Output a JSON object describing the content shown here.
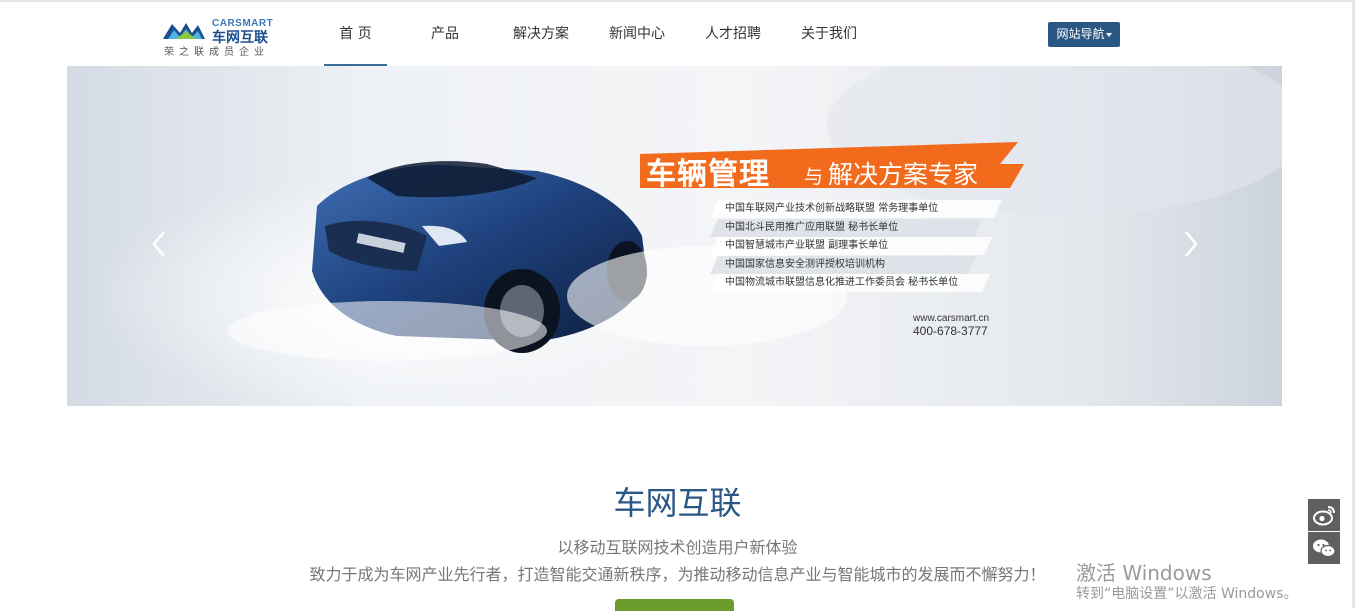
{
  "logo": {
    "brand_en": "CARSMART",
    "brand_cn": "车网互联",
    "tagline": "荣之联成员企业"
  },
  "nav": {
    "items": [
      {
        "label": "首 页",
        "active": true
      },
      {
        "label": "产品"
      },
      {
        "label": "解决方案"
      },
      {
        "label": "新闻中心"
      },
      {
        "label": "人才招聘"
      },
      {
        "label": "关于我们"
      }
    ],
    "site_nav_label": "网站导航"
  },
  "banner": {
    "headline": "车辆管理",
    "headline_yu": "与",
    "headline_rest": "解决方案专家",
    "memberships": [
      "中国车联网产业技术创新战略联盟 常务理事单位",
      "中国北斗民用推广应用联盟 秘书长单位",
      "中国智慧城市产业联盟 副理事长单位",
      "中国国家信息安全测评授权培训机构",
      "中国物流城市联盟信息化推进工作委员会 秘书长单位"
    ],
    "website": "www.carsmart.cn",
    "phone": "400-678-3777",
    "accent_color": "#f26b1d"
  },
  "intro": {
    "title": "车网互联",
    "subtitle": "以移动互联网技术创造用户新体验",
    "description": "致力于成为车网产业先行者，打造智能交通新秩序，为推动移动信息产业与智能城市的发展而不懈努力！"
  },
  "social": {
    "weibo_icon": "weibo-icon",
    "wechat_icon": "wechat-icon"
  },
  "watermark": {
    "line1": "激活 Windows",
    "line2": "转到“电脑设置”以激活 Windows。"
  },
  "colors": {
    "brand_blue": "#2b5784",
    "nav_underline": "#3a6c94",
    "green_button": "#6a9b2b"
  }
}
